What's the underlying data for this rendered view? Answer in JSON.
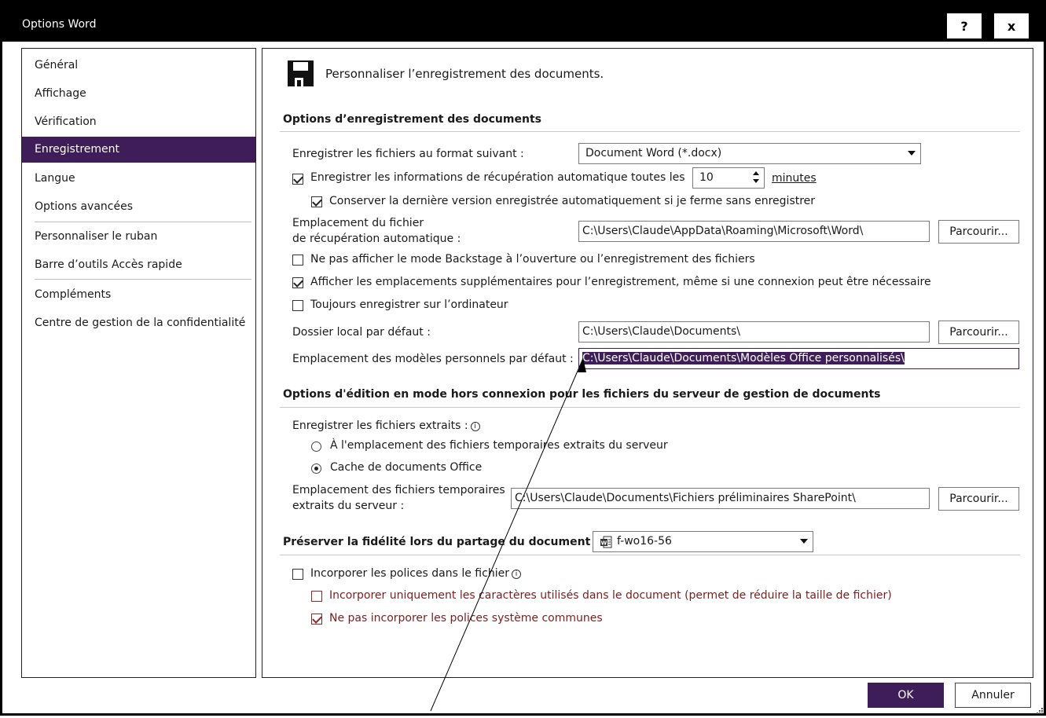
{
  "window": {
    "title": "Options Word",
    "help_label": "?",
    "close_label": "x"
  },
  "sidebar": {
    "items": [
      {
        "label": "Général"
      },
      {
        "label": "Affichage"
      },
      {
        "label": "Vérification"
      },
      {
        "label": "Enregistrement",
        "selected": true
      },
      {
        "label": "Langue"
      },
      {
        "label": "Options avancées"
      },
      {
        "label": "Personnaliser le ruban"
      },
      {
        "label": "Barre d’outils Accès rapide"
      },
      {
        "label": "Compléments"
      },
      {
        "label": "Centre de gestion de la confidentialité"
      }
    ]
  },
  "main": {
    "heading": "Personnaliser l’enregistrement des documents.",
    "save_section": {
      "title": "Options d’enregistrement des documents",
      "format_label": "Enregistrer les fichiers au format suivant :",
      "format_value": "Document Word (*.docx)",
      "autorecover_label": "Enregistrer les informations de récupération automatique toutes les",
      "autorecover_minutes": "10",
      "minutes_label": "minutes",
      "keep_last_label": "Conserver la dernière version enregistrée automatiquement si je ferme sans enregistrer",
      "autorecover_location_label_1": "Emplacement du fichier",
      "autorecover_location_label_2": "de récupération automatique :",
      "autorecover_location_value": "C:\\Users\\Claude\\AppData\\Roaming\\Microsoft\\Word\\",
      "browse_label": "Parcourir...",
      "no_backstage_label": "Ne pas afficher le mode Backstage à l’ouverture ou l’enregistrement des fichiers",
      "show_additional_label": "Afficher les emplacements supplémentaires pour l’enregistrement, même si une connexion peut être nécessaire",
      "always_save_local_label": "Toujours enregistrer sur l’ordinateur",
      "default_local_label": "Dossier local par défaut :",
      "default_local_value": "C:\\Users\\Claude\\Documents\\",
      "default_templates_label": "Emplacement des modèles personnels par défaut :",
      "default_templates_value": "C:\\Users\\Claude\\Documents\\Modèles Office personnalisés\\"
    },
    "offline_section": {
      "title": "Options d'édition en mode hors connexion pour les fichiers du serveur de gestion de documents",
      "checked_out_label": "Enregistrer les fichiers extraits :",
      "radio_temp_label": "À l'emplacement des fichiers temporaires extraits du serveur",
      "radio_cache_label": "Cache de documents Office",
      "drafts_label_1": "Emplacement des fichiers temporaires",
      "drafts_label_2": "extraits du serveur :",
      "drafts_value": "C:\\Users\\Claude\\Documents\\Fichiers préliminaires SharePoint\\",
      "browse_label": "Parcourir..."
    },
    "fidelity_section": {
      "title": "Préserver la fidélité lors du partage du document :",
      "document_value": "f-wo16-56",
      "embed_fonts_label": "Incorporer les polices dans le fichier",
      "embed_used_only_label": "Incorporer uniquement les caractères utilisés dans le document (permet de réduire la taille de fichier)",
      "no_common_fonts_label": "Ne pas incorporer les polices système communes"
    }
  },
  "footer": {
    "ok_label": "OK",
    "cancel_label": "Annuler"
  },
  "colors": {
    "accent": "#3e1d59",
    "titlebar": "#000000",
    "disabled_red": "#7a1f1f"
  },
  "icons": [
    "save-icon",
    "word-document-icon",
    "info-icon",
    "chevron-down-icon",
    "spinner-arrows-icon",
    "resize-grip-icon"
  ]
}
